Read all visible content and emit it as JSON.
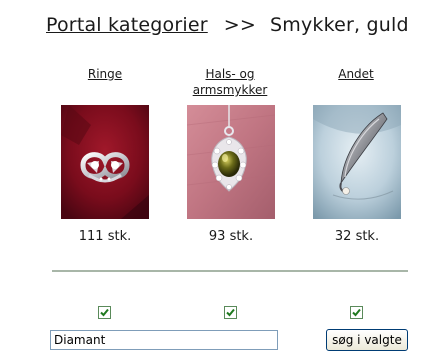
{
  "breadcrumb": {
    "parent_label": "Portal kategorier",
    "separator": ">>",
    "current": "Smykker, guld"
  },
  "categories": [
    {
      "label": "Ringe",
      "count": "111 stk.",
      "image": "rings-photo",
      "checked": true
    },
    {
      "label": "Hals- og armsmykker",
      "count": "93 stk.",
      "image": "pendant-photo",
      "checked": true
    },
    {
      "label": "Andet",
      "count": "32 stk.",
      "image": "brooch-photo",
      "checked": true
    }
  ],
  "search": {
    "value": "Diamant",
    "button_label": "søg i valgte"
  },
  "colors": {
    "divider": "#a8b6a8",
    "checkmark": "#1f7a1f"
  }
}
